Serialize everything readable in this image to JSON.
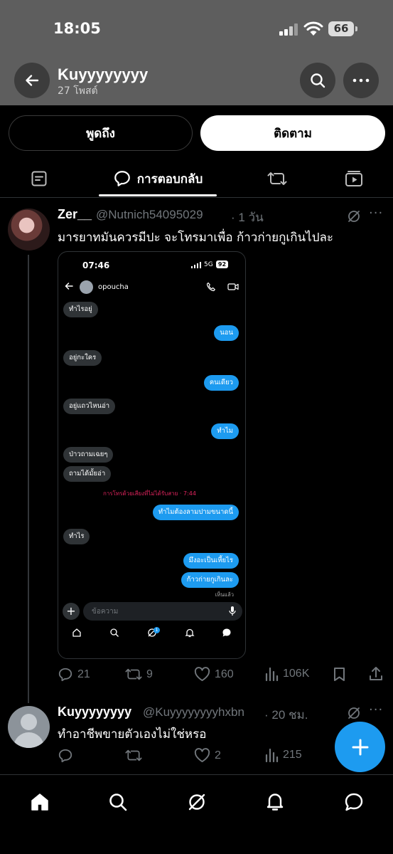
{
  "status_bar": {
    "time": "18:05",
    "battery": "66"
  },
  "header": {
    "title": "Kuyyyyyyyy",
    "subtitle": "27 โพสต์"
  },
  "profile_actions": {
    "mention": "พูดถึง",
    "follow": "ติดตาม"
  },
  "tabs": {
    "replies_label": "การตอบกลับ"
  },
  "post1": {
    "name": "Zer__",
    "handle": "@Nutnich54095029",
    "time": "· 1 วัน",
    "text": "มารยาทมันควรมีปะ จะโทรมาเพื่อ ก้าวก่ายกูเกินไปละ",
    "replies": "21",
    "reposts": "9",
    "likes": "160",
    "views": "106K",
    "screenshot": {
      "time": "07:46",
      "network": "5G",
      "battery": "92",
      "contact": "opoucha",
      "messages": [
        {
          "dir": "in",
          "text": "ทำไรอยู่"
        },
        {
          "dir": "out",
          "text": "นอน"
        },
        {
          "dir": "in",
          "text": "อยู่กะใคร"
        },
        {
          "dir": "out",
          "text": "คนเดียว"
        },
        {
          "dir": "in",
          "text": "อยู่แถวไหนอ่า"
        },
        {
          "dir": "out",
          "text": "ทำไม"
        },
        {
          "dir": "in",
          "text": "ป่าวถามเฉยๆ"
        },
        {
          "dir": "in",
          "text": "ถามได้มั้ยอ่า"
        },
        {
          "dir": "out",
          "text": "ทำไมต้องลามปามขนาดนี้"
        },
        {
          "dir": "in",
          "text": "ทำไร"
        },
        {
          "dir": "out",
          "text": "มึงอะเป็นเหี้ยไร"
        },
        {
          "dir": "out",
          "text": "ก้าวก่ายกูเกินละ"
        }
      ],
      "missed_call": "การโทรด้วยเสียงที่ไม่ได้รับสาย · 7:44",
      "seen": "เห็นแล้ว",
      "input_placeholder": "ข้อความ",
      "badge": "1"
    }
  },
  "post2": {
    "name": "Kuyyyyyyyy",
    "handle": "@Kuyyyyyyyyhxbn",
    "time": "· 20 ชม.",
    "text": "ทำอาชีพขายตัวเองไม่ใช่หรอ",
    "likes": "2",
    "views": "215"
  },
  "icons": [
    "back-arrow-icon",
    "search-icon",
    "more-icon",
    "posts-icon",
    "reply-icon",
    "repost-icon",
    "media-icon",
    "grok-icon",
    "like-icon",
    "views-icon",
    "bookmark-icon",
    "share-icon",
    "plus-icon",
    "home-icon",
    "bell-icon",
    "message-icon"
  ],
  "colors": {
    "accent": "#1d9bf0",
    "missed": "#e0245e"
  }
}
